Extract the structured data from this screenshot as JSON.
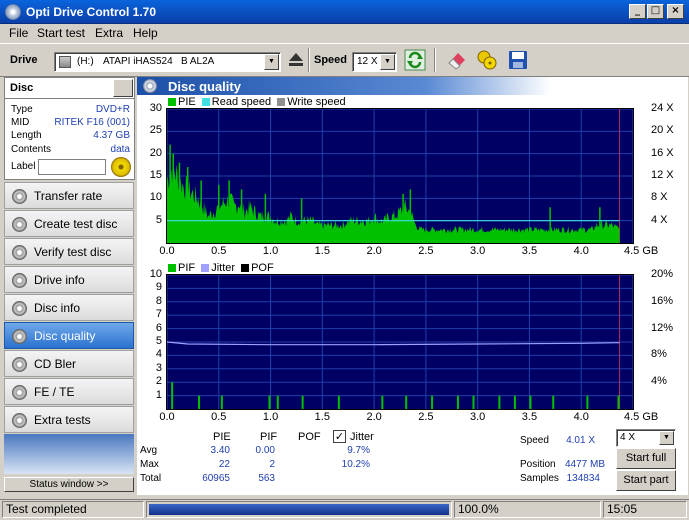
{
  "window": {
    "title": "Opti Drive Control 1.70"
  },
  "menu": [
    "File",
    "Start test",
    "Extra",
    "Help"
  ],
  "toolbar": {
    "drive_label": "Drive",
    "drive_letter": "(H:)",
    "drive_name": "ATAPI iHAS524   B AL2A",
    "speed_label": "Speed",
    "speed_value": "12 X"
  },
  "disc": {
    "header": "Disc",
    "rows": [
      {
        "label": "Type",
        "value": "DVD+R"
      },
      {
        "label": "MID",
        "value": "RITEK F16 (001)"
      },
      {
        "label": "Length",
        "value": "4.37 GB"
      },
      {
        "label": "Contents",
        "value": "data"
      }
    ],
    "label_field": "Label"
  },
  "nav": [
    {
      "label": "Transfer rate",
      "active": false
    },
    {
      "label": "Create test disc",
      "active": false
    },
    {
      "label": "Verify test disc",
      "active": false
    },
    {
      "label": "Drive info",
      "active": false
    },
    {
      "label": "Disc info",
      "active": false
    },
    {
      "label": "Disc quality",
      "active": true
    },
    {
      "label": "CD Bler",
      "active": false
    },
    {
      "label": "FE / TE",
      "active": false
    },
    {
      "label": "Extra tests",
      "active": false
    }
  ],
  "status_window_btn": "Status window >>",
  "panel_title": "Disc quality",
  "chart_data": [
    {
      "type": "area",
      "legend": [
        "PIE",
        "Read speed",
        "Write speed"
      ],
      "colors": {
        "PIE": "#00c000",
        "Read speed": "#40e0e0",
        "Write speed": "#909090",
        "background": "#000064",
        "grid": "#1a3fb0"
      },
      "x_ticks": [
        "0.0",
        "0.5",
        "1.0",
        "1.5",
        "2.0",
        "2.5",
        "3.0",
        "3.5",
        "4.0",
        "4.5 GB"
      ],
      "y_ticks": [
        "5",
        "10",
        "15",
        "20",
        "25",
        "30"
      ],
      "y2_ticks": [
        "4 X",
        "8 X",
        "12 X",
        "16 X",
        "20 X",
        "24 X"
      ],
      "xlim": [
        0,
        4.5
      ],
      "ylim": [
        0,
        30
      ],
      "y2lim": [
        0,
        24
      ],
      "read_speed": [
        [
          0,
          4
        ],
        [
          4.37,
          4
        ]
      ],
      "pie_envelope": [
        [
          0,
          14
        ],
        [
          0.05,
          17
        ],
        [
          0.1,
          15
        ],
        [
          0.15,
          13
        ],
        [
          0.2,
          12
        ],
        [
          0.25,
          11
        ],
        [
          0.3,
          10
        ],
        [
          0.35,
          8
        ],
        [
          0.4,
          6
        ],
        [
          0.45,
          7
        ],
        [
          0.5,
          8
        ],
        [
          0.55,
          9
        ],
        [
          0.6,
          10
        ],
        [
          0.65,
          8
        ],
        [
          0.7,
          9
        ],
        [
          0.75,
          7
        ],
        [
          0.8,
          8
        ],
        [
          0.85,
          7
        ],
        [
          0.9,
          6
        ],
        [
          0.95,
          6
        ],
        [
          1.0,
          6
        ],
        [
          1.05,
          5
        ],
        [
          1.1,
          5
        ],
        [
          1.15,
          5
        ],
        [
          1.2,
          6
        ],
        [
          1.25,
          5
        ],
        [
          1.3,
          5
        ],
        [
          1.35,
          5
        ],
        [
          1.4,
          5
        ],
        [
          1.45,
          4
        ],
        [
          1.5,
          4
        ],
        [
          1.55,
          4
        ],
        [
          1.6,
          4
        ],
        [
          1.65,
          4
        ],
        [
          1.7,
          4
        ],
        [
          1.75,
          5
        ],
        [
          1.8,
          5
        ],
        [
          1.85,
          5
        ],
        [
          1.9,
          5
        ],
        [
          1.95,
          5
        ],
        [
          2.0,
          6
        ],
        [
          2.05,
          5
        ],
        [
          2.1,
          5
        ],
        [
          2.15,
          6
        ],
        [
          2.2,
          6
        ],
        [
          2.25,
          7
        ],
        [
          2.3,
          8
        ],
        [
          2.35,
          7
        ],
        [
          2.4,
          4
        ],
        [
          2.45,
          3
        ],
        [
          2.5,
          3
        ],
        [
          2.55,
          3
        ],
        [
          2.6,
          3
        ],
        [
          2.65,
          3
        ],
        [
          2.7,
          3
        ],
        [
          2.75,
          3
        ],
        [
          2.8,
          3
        ],
        [
          2.85,
          3
        ],
        [
          2.9,
          3
        ],
        [
          2.95,
          3
        ],
        [
          3.0,
          3
        ],
        [
          3.05,
          3
        ],
        [
          3.1,
          3
        ],
        [
          3.15,
          3
        ],
        [
          3.2,
          3
        ],
        [
          3.25,
          3
        ],
        [
          3.3,
          3
        ],
        [
          3.35,
          3
        ],
        [
          3.4,
          3
        ],
        [
          3.45,
          3
        ],
        [
          3.5,
          3
        ],
        [
          3.55,
          3
        ],
        [
          3.6,
          3
        ],
        [
          3.65,
          3
        ],
        [
          3.7,
          3
        ],
        [
          3.75,
          3
        ],
        [
          3.8,
          3
        ],
        [
          3.85,
          3
        ],
        [
          3.9,
          3
        ],
        [
          3.95,
          3
        ],
        [
          4.0,
          3
        ],
        [
          4.05,
          3
        ],
        [
          4.1,
          3
        ],
        [
          4.15,
          4
        ],
        [
          4.2,
          4
        ],
        [
          4.25,
          4
        ],
        [
          4.3,
          4
        ],
        [
          4.37,
          3
        ]
      ]
    },
    {
      "type": "bar",
      "legend": [
        "PIF",
        "Jitter",
        "POF"
      ],
      "colors": {
        "PIF": "#00c000",
        "Jitter": "#a0a0ff",
        "POF": "#000000"
      },
      "x_ticks": [
        "0.0",
        "0.5",
        "1.0",
        "1.5",
        "2.0",
        "2.5",
        "3.0",
        "3.5",
        "4.0",
        "4.5 GB"
      ],
      "y_ticks": [
        "1",
        "2",
        "3",
        "4",
        "5",
        "6",
        "7",
        "8",
        "9",
        "10"
      ],
      "y2_ticks": [
        "4%",
        "8%",
        "12%",
        "16%",
        "20%"
      ],
      "xlim": [
        0,
        4.5
      ],
      "ylim": [
        0,
        10
      ],
      "y2lim": [
        0,
        20
      ],
      "jitter": [
        [
          0,
          10.0
        ],
        [
          0.2,
          9.7
        ],
        [
          1.0,
          9.6
        ],
        [
          2.0,
          9.6
        ],
        [
          3.0,
          9.7
        ],
        [
          4.0,
          9.8
        ],
        [
          4.37,
          9.9
        ]
      ],
      "pif_bars": [
        [
          0.04,
          2
        ],
        [
          0.3,
          1
        ],
        [
          0.52,
          1
        ],
        [
          0.98,
          1
        ],
        [
          1.06,
          1
        ],
        [
          1.3,
          1
        ],
        [
          1.65,
          1
        ],
        [
          2.07,
          1
        ],
        [
          2.3,
          1
        ],
        [
          2.55,
          1
        ],
        [
          2.8,
          1
        ],
        [
          2.95,
          1
        ],
        [
          3.2,
          1
        ],
        [
          3.35,
          1
        ],
        [
          3.5,
          1
        ],
        [
          3.72,
          1
        ],
        [
          4.05,
          1
        ],
        [
          4.35,
          1
        ]
      ]
    }
  ],
  "stats": {
    "headers": [
      "PIE",
      "PIF",
      "POF"
    ],
    "jitter_label": "Jitter",
    "jitter_checked": true,
    "rows": [
      {
        "label": "Avg",
        "pie": "3.40",
        "pif": "0.00",
        "pof": "",
        "jitter": "9.7%"
      },
      {
        "label": "Max",
        "pie": "22",
        "pif": "2",
        "pof": "",
        "jitter": "10.2%"
      },
      {
        "label": "Total",
        "pie": "60965",
        "pif": "563",
        "pof": "",
        "jitter": ""
      }
    ],
    "speed_label": "Speed",
    "speed_value": "4.01 X",
    "position_label": "Position",
    "position_value": "4477 MB",
    "samples_label": "Samples",
    "samples_value": "134834",
    "speed_select": "4 X",
    "start_full": "Start full",
    "start_part": "Start part"
  },
  "statusbar": {
    "text": "Test completed",
    "progress": 100,
    "progress_text": "100.0%",
    "time": "15:05"
  }
}
